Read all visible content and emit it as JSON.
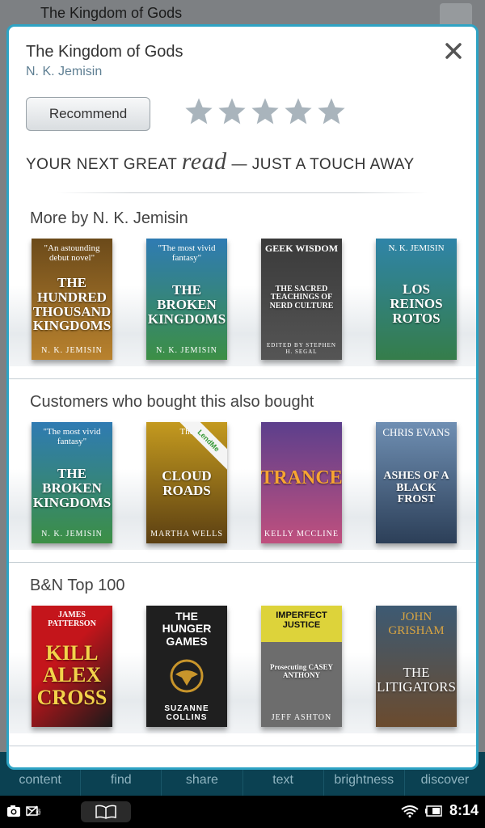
{
  "reader": {
    "title": "The Kingdom of Gods"
  },
  "dialog": {
    "title": "The Kingdom of Gods",
    "author": "N. K. Jemisin",
    "recommend_label": "Recommend",
    "rating": 0,
    "rating_max": 5,
    "tagline_before": "YOUR NEXT GREAT",
    "tagline_em": "read",
    "tagline_after": "— JUST A TOUCH AWAY"
  },
  "sections": [
    {
      "title": "More by N. K. Jemisin",
      "books": [
        {
          "top": "\"An astounding debut novel\"",
          "title": "THE HUNDRED THOUSAND KINGDOMS",
          "author": "N. K. JEMISIN",
          "bg": "#6b4a1a",
          "bg2": "#b9822e"
        },
        {
          "top": "\"The most vivid fantasy\"",
          "title": "THE BROKEN KINGDOMS",
          "author": "N. K. JEMISIN",
          "bg": "#2f7bb3",
          "bg2": "#3c8f45"
        },
        {
          "top": "GEEK WISDOM",
          "title": "THE SACRED TEACHINGS OF NERD CULTURE",
          "author": "EDITED BY STEPHEN H. SEGAL",
          "bg": "#3a3a3a",
          "bg2": "#555555"
        },
        {
          "top": "N. K. JEMISIN",
          "title": "LOS REINOS ROTOS",
          "author": "",
          "bg": "#2f84a8",
          "bg2": "#357d4a"
        }
      ]
    },
    {
      "title": "Customers who bought this also bought",
      "books": [
        {
          "top": "\"The most vivid fantasy\"",
          "title": "THE BROKEN KINGDOMS",
          "author": "N. K. JEMISIN",
          "bg": "#2f7bb3",
          "bg2": "#3c8f45"
        },
        {
          "top": "The",
          "title": "CLOUD ROADS",
          "author": "MARTHA WELLS",
          "bg": "#c49a1f",
          "bg2": "#5b3f12",
          "badge": "LendMe"
        },
        {
          "top": "",
          "title": "TRANCE",
          "author": "KELLY MCCLINE",
          "bg": "#5c3f8c",
          "bg2": "#c0507e"
        },
        {
          "top": "CHRIS EVANS",
          "title": "ASHES OF A BLACK FROST",
          "author": "",
          "bg": "#6f8fb3",
          "bg2": "#2c3f58"
        }
      ]
    },
    {
      "title": "B&N Top 100",
      "books": [
        {
          "top": "JAMES PATTERSON",
          "title": "KILL ALEX CROSS",
          "author": "",
          "bg": "#c4151b",
          "bg2": "#1a1a1a"
        },
        {
          "top": "THE HUNGER GAMES",
          "title": "",
          "author": "SUZANNE COLLINS",
          "bg": "#1f1f1f",
          "bg2": "#2a2a2a"
        },
        {
          "top": "IMPERFECT JUSTICE",
          "title": "Prosecuting CASEY ANTHONY",
          "author": "JEFF ASHTON",
          "bg": "#ddd33a",
          "bg2": "#6d6d6d"
        },
        {
          "top": "JOHN GRISHAM",
          "title": "THE LITIGATORS",
          "author": "",
          "bg": "#3d5a73",
          "bg2": "#6b4b2e"
        }
      ]
    }
  ],
  "toolbar": [
    "content",
    "find",
    "share",
    "text",
    "brightness",
    "discover"
  ],
  "status": {
    "time": "8:14"
  },
  "colors": {
    "accent": "#2ea3c4",
    "toolbar_bg": "#0b4152",
    "star": "#a9b4bc"
  }
}
